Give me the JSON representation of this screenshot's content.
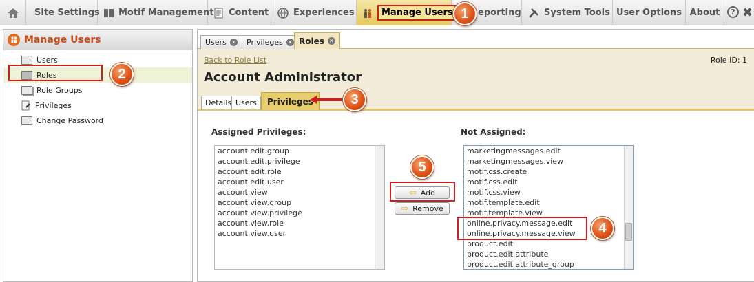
{
  "topnav": {
    "items": [
      {
        "label": "",
        "icon": "home-icon"
      },
      {
        "label": "Site Settings",
        "icon": ""
      },
      {
        "label": "Motif Management",
        "icon": "book-icon"
      },
      {
        "label": "Content",
        "icon": "document-icon"
      },
      {
        "label": "Experiences",
        "icon": "globe-icon"
      },
      {
        "label": "Manage Users",
        "icon": "users-icon"
      },
      {
        "label": "eporting",
        "icon": ""
      },
      {
        "label": "System Tools",
        "icon": "tools-icon"
      },
      {
        "label": "User Options",
        "icon": ""
      },
      {
        "label": "About",
        "icon": ""
      }
    ],
    "help_label": "?",
    "close_label": "✖"
  },
  "callouts": [
    "1",
    "2",
    "3",
    "4",
    "5"
  ],
  "left_panel": {
    "title": "Manage Users",
    "items": [
      "Users",
      "Roles",
      "Role Groups",
      "Privileges",
      "Change Password"
    ]
  },
  "tabs": [
    "Users",
    "Privileges",
    "Roles"
  ],
  "role": {
    "back_link": "Back to Role List",
    "role_id": "Role ID: 1",
    "title": "Account Administrator",
    "subtabs": [
      "Details",
      "Users",
      "Privileges"
    ]
  },
  "assigned": {
    "label": "Assigned Privileges:",
    "items": [
      "account.edit.group",
      "account.edit.privilege",
      "account.edit.role",
      "account.edit.user",
      "account.view",
      "account.view.group",
      "account.view.privilege",
      "account.view.role",
      "account.view.user"
    ]
  },
  "not_assigned": {
    "label": "Not Assigned:",
    "items": [
      "marketingmessages.edit",
      "marketingmessages.view",
      "motif.css.create",
      "motif.css.edit",
      "motif.css.view",
      "motif.template.edit",
      "motif.template.view",
      "online.privacy.message.edit",
      "online.privacy.message.view",
      "product.edit",
      "product.edit.attribute",
      "product.edit.attribute_group"
    ]
  },
  "buttons": {
    "add": "Add",
    "remove": "Remove"
  },
  "colors": {
    "accent": "#e6c85f",
    "callout": "#e0551a",
    "highlight_box": "#d21e1e",
    "brand_orange": "#c8501a"
  }
}
